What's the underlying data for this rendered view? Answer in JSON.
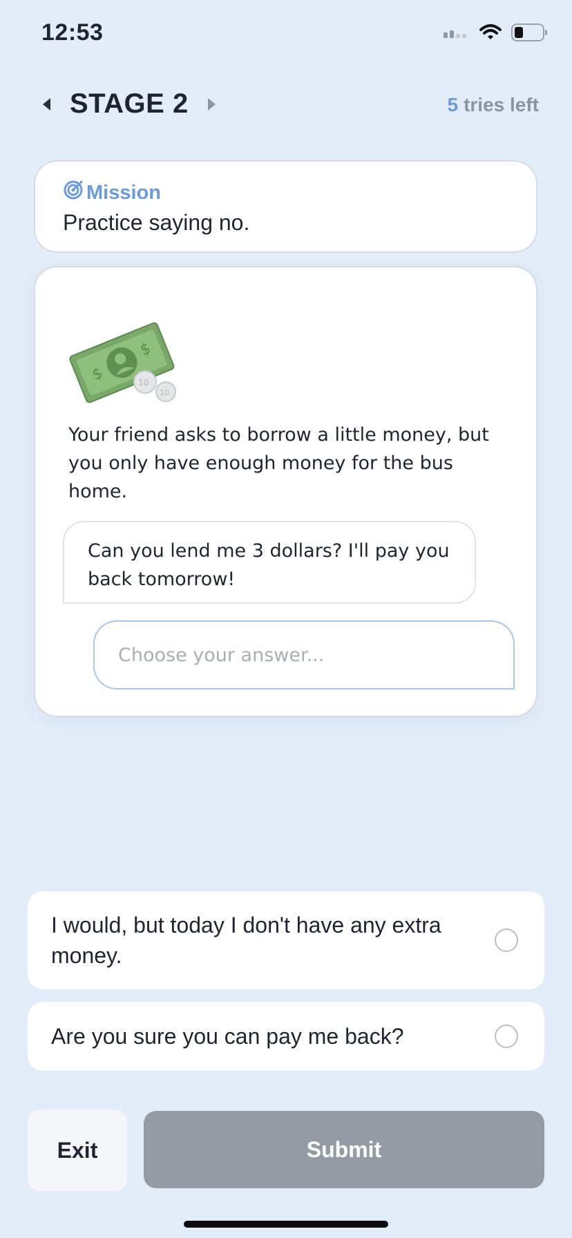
{
  "status_bar": {
    "time": "12:53",
    "icons": [
      "cellular-signal-icon",
      "wifi-icon",
      "battery-icon"
    ]
  },
  "header": {
    "stage_title": "STAGE 2",
    "tries_count": "5",
    "tries_label": "tries left"
  },
  "mission": {
    "label": "Mission",
    "icon": "target-icon",
    "text": "Practice saying no."
  },
  "scenario": {
    "illustration": "money-illustration",
    "text": "Your friend asks to borrow a little money, but you only have enough money for the bus home.",
    "friend_message": "Can you lend me 3 dollars? I'll pay you back tomorrow!",
    "answer_placeholder": "Choose your answer..."
  },
  "options": [
    {
      "text": "I would, but today I don't have any extra money.",
      "selected": false
    },
    {
      "text": "Are you sure you can pay me back?",
      "selected": false
    }
  ],
  "buttons": {
    "exit": "Exit",
    "submit": "Submit"
  },
  "colors": {
    "background": "#e3edf9",
    "accent": "#6a9be0",
    "submit_disabled": "#959ba5"
  }
}
